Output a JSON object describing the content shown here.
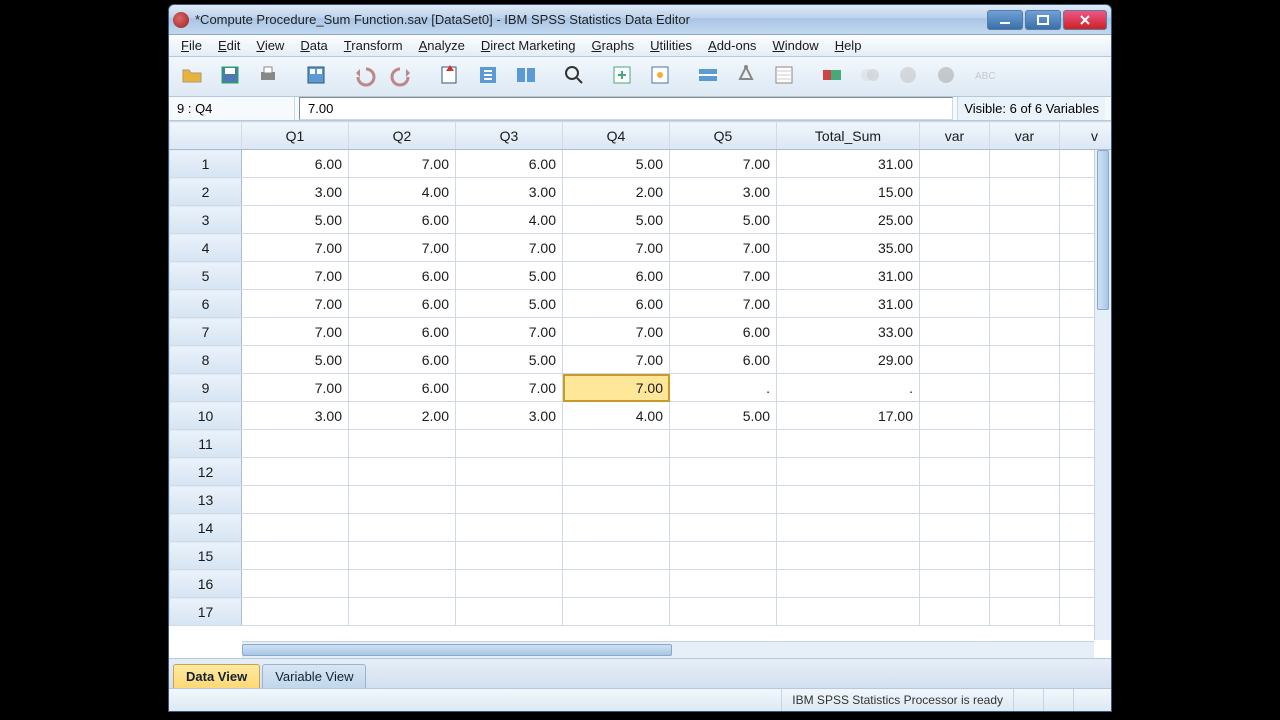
{
  "titlebar": {
    "title": "*Compute Procedure_Sum Function.sav [DataSet0] - IBM SPSS Statistics Data Editor"
  },
  "menu": [
    "File",
    "Edit",
    "View",
    "Data",
    "Transform",
    "Analyze",
    "Direct Marketing",
    "Graphs",
    "Utilities",
    "Add-ons",
    "Window",
    "Help"
  ],
  "toolbar_icons": [
    "open",
    "save",
    "print",
    "data-props",
    "undo",
    "redo",
    "goto-case",
    "goto-var",
    "variables",
    "find",
    "insert-case",
    "insert-var",
    "split-file",
    "weight",
    "select-cases",
    "value-labels",
    "use-sets",
    "spellcheck-a",
    "spellcheck-b",
    "abc"
  ],
  "info": {
    "cellref": "9 : Q4",
    "cellvalue": "7.00",
    "visible": "Visible: 6 of 6 Variables"
  },
  "columns": [
    "Q1",
    "Q2",
    "Q3",
    "Q4",
    "Q5",
    "Total_Sum",
    "var",
    "var",
    "v"
  ],
  "rows": [
    {
      "n": "1",
      "c": [
        "6.00",
        "7.00",
        "6.00",
        "5.00",
        "7.00",
        "31.00",
        "",
        "",
        ""
      ]
    },
    {
      "n": "2",
      "c": [
        "3.00",
        "4.00",
        "3.00",
        "2.00",
        "3.00",
        "15.00",
        "",
        "",
        ""
      ]
    },
    {
      "n": "3",
      "c": [
        "5.00",
        "6.00",
        "4.00",
        "5.00",
        "5.00",
        "25.00",
        "",
        "",
        ""
      ]
    },
    {
      "n": "4",
      "c": [
        "7.00",
        "7.00",
        "7.00",
        "7.00",
        "7.00",
        "35.00",
        "",
        "",
        ""
      ]
    },
    {
      "n": "5",
      "c": [
        "7.00",
        "6.00",
        "5.00",
        "6.00",
        "7.00",
        "31.00",
        "",
        "",
        ""
      ]
    },
    {
      "n": "6",
      "c": [
        "7.00",
        "6.00",
        "5.00",
        "6.00",
        "7.00",
        "31.00",
        "",
        "",
        ""
      ]
    },
    {
      "n": "7",
      "c": [
        "7.00",
        "6.00",
        "7.00",
        "7.00",
        "6.00",
        "33.00",
        "",
        "",
        ""
      ]
    },
    {
      "n": "8",
      "c": [
        "5.00",
        "6.00",
        "5.00",
        "7.00",
        "6.00",
        "29.00",
        "",
        "",
        ""
      ]
    },
    {
      "n": "9",
      "c": [
        "7.00",
        "6.00",
        "7.00",
        "7.00",
        ".",
        ".",
        "",
        "",
        ""
      ]
    },
    {
      "n": "10",
      "c": [
        "3.00",
        "2.00",
        "3.00",
        "4.00",
        "5.00",
        "17.00",
        "",
        "",
        ""
      ]
    },
    {
      "n": "11",
      "c": [
        "",
        "",
        "",
        "",
        "",
        "",
        "",
        "",
        ""
      ]
    },
    {
      "n": "12",
      "c": [
        "",
        "",
        "",
        "",
        "",
        "",
        "",
        "",
        ""
      ]
    },
    {
      "n": "13",
      "c": [
        "",
        "",
        "",
        "",
        "",
        "",
        "",
        "",
        ""
      ]
    },
    {
      "n": "14",
      "c": [
        "",
        "",
        "",
        "",
        "",
        "",
        "",
        "",
        ""
      ]
    },
    {
      "n": "15",
      "c": [
        "",
        "",
        "",
        "",
        "",
        "",
        "",
        "",
        ""
      ]
    },
    {
      "n": "16",
      "c": [
        "",
        "",
        "",
        "",
        "",
        "",
        "",
        "",
        ""
      ]
    },
    {
      "n": "17",
      "c": [
        "",
        "",
        "",
        "",
        "",
        "",
        "",
        "",
        ""
      ]
    }
  ],
  "selected": {
    "row": 8,
    "col": 3
  },
  "tabs": {
    "data": "Data View",
    "variable": "Variable View"
  },
  "status": "IBM SPSS Statistics Processor is ready"
}
